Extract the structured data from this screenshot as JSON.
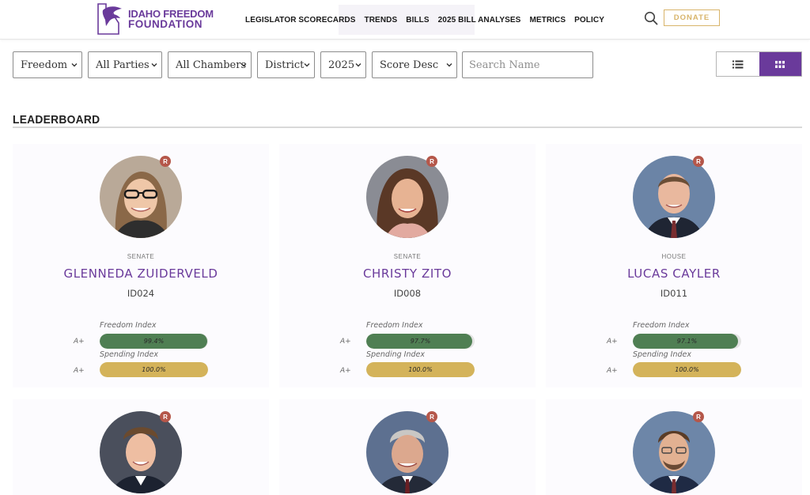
{
  "header": {
    "logo": {
      "line1": "IDAHO FREEDOM",
      "line2": "FOUNDATION"
    },
    "nav": [
      "LEGISLATOR SCORECARDS",
      "TRENDS",
      "BILLS",
      "2025 BILL ANALYSES",
      "METRICS",
      "POLICY"
    ],
    "search_icon": "search-icon",
    "donate_label": "DONATE"
  },
  "filters": {
    "index": "Freedom",
    "party": "All Parties",
    "chamber": "All Chambers",
    "district": "District",
    "year": "2025",
    "sort": "Score Desc",
    "search_placeholder": "Search Name"
  },
  "view_toggle": {
    "list_icon": "list-icon",
    "grid_icon": "grid-icon",
    "active": "grid"
  },
  "leaderboard": {
    "title": "LEADERBOARD",
    "freedom_label": "Freedom Index",
    "spending_label": "Spending Index",
    "legislators": [
      {
        "party": "R",
        "chamber": "SENATE",
        "name": "GLENNEDA ZUIDERVELD",
        "district": "ID024",
        "freedom_grade": "A+",
        "freedom_score": 99.4,
        "freedom_text": "99.4%",
        "spending_grade": "A+",
        "spending_score": 100.0,
        "spending_text": "100.0%"
      },
      {
        "party": "R",
        "chamber": "SENATE",
        "name": "CHRISTY ZITO",
        "district": "ID008",
        "freedom_grade": "A+",
        "freedom_score": 97.7,
        "freedom_text": "97.7%",
        "spending_grade": "A+",
        "spending_score": 100.0,
        "spending_text": "100.0%"
      },
      {
        "party": "R",
        "chamber": "HOUSE",
        "name": "LUCAS CAYLER",
        "district": "ID011",
        "freedom_grade": "A+",
        "freedom_score": 97.1,
        "freedom_text": "97.1%",
        "spending_grade": "A+",
        "spending_score": 100.0,
        "spending_text": "100.0%"
      },
      {
        "party": "R"
      },
      {
        "party": "R"
      },
      {
        "party": "R"
      }
    ]
  },
  "colors": {
    "brand_purple": "#6a3a9b",
    "donate_gold": "#d8b46a",
    "freedom_green": "#4f7f53",
    "spending_gold": "#d4b35a",
    "party_red": "#b5574a"
  }
}
